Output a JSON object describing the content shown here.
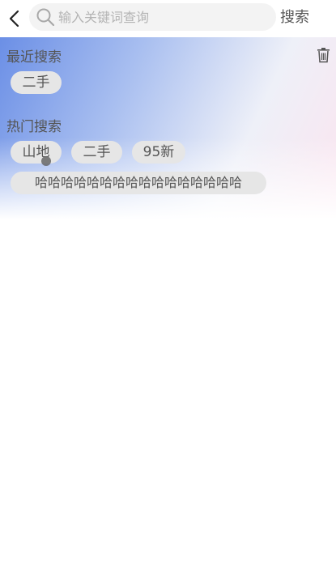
{
  "header": {
    "back_icon": "chevron-left-icon",
    "search_icon": "search-icon",
    "search_placeholder": "输入关键词查询",
    "search_value": "",
    "search_button_label": "搜索"
  },
  "recent": {
    "title": "最近搜索",
    "clear_icon": "trash-icon",
    "tags": [
      "二手"
    ]
  },
  "hot": {
    "title": "热门搜索",
    "tags": [
      "山地",
      "二手",
      "95新",
      "哈哈哈哈哈哈哈哈哈哈哈哈哈哈哈哈"
    ]
  },
  "colors": {
    "gradient_blue": "#6b8fe6",
    "gradient_pink": "#fbe4ef",
    "tag_background": "#e6e6e6"
  }
}
